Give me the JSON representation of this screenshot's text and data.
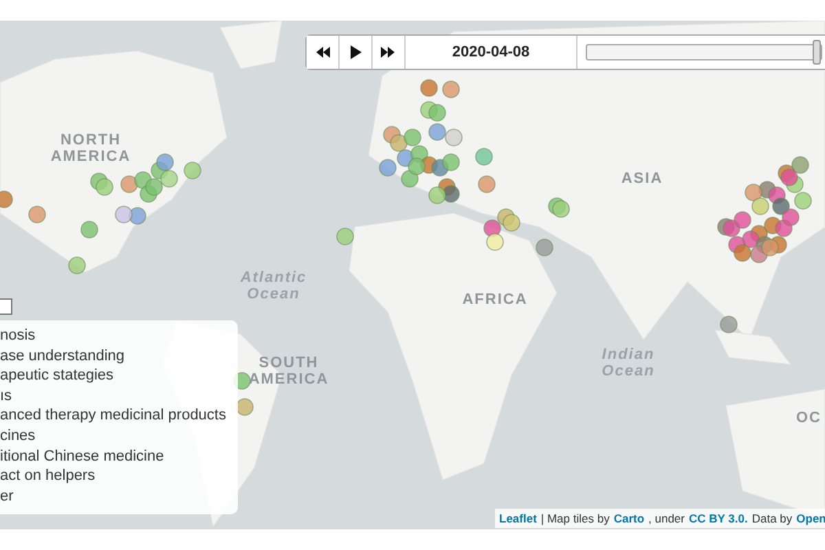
{
  "timeline": {
    "date": "2020-04-08",
    "slider": {
      "level": 1
    }
  },
  "map_labels": {
    "north_america": "NORTH AMERICA",
    "atlantic": "Atlantic Ocean",
    "south_america": "SOUTH AMERICA",
    "africa": "AFRICA",
    "asia": "ASIA",
    "indian": "Indian Ocean",
    "oceania": "OC"
  },
  "legend": {
    "items": [
      "nosis",
      "ase understanding",
      "apeutic stategies",
      "ıs",
      "anced therapy medicinal products",
      "cines",
      "itional Chinese medicine",
      "act on helpers",
      "er"
    ]
  },
  "attribution": [
    {
      "kind": "link",
      "text": "Leaflet"
    },
    {
      "kind": "text",
      "text": "| Map tiles by"
    },
    {
      "kind": "link",
      "text": "Carto"
    },
    {
      "kind": "text",
      "text": ", under"
    },
    {
      "kind": "link",
      "text": "CC BY 3.0."
    },
    {
      "kind": "text",
      "text": "Data by"
    },
    {
      "kind": "link",
      "text": "Open"
    }
  ]
}
